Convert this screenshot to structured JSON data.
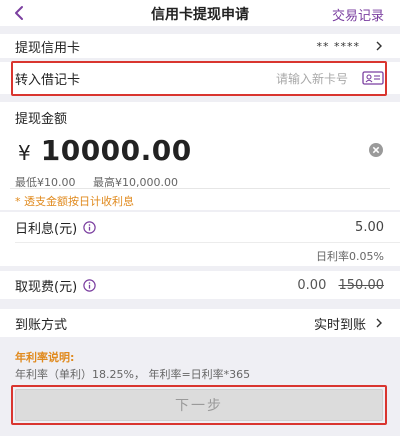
{
  "header": {
    "title": "信用卡提现申请",
    "records": "交易记录"
  },
  "credit_card": {
    "label": "提现信用卡",
    "value": "** ****"
  },
  "debit_card": {
    "label": "转入借记卡",
    "placeholder": "请输入新卡号"
  },
  "amount": {
    "title": "提现金额",
    "currency": "¥",
    "value": "10000.00",
    "min": "最低¥10.00",
    "max": "最高¥10,000.00",
    "notice": "* 透支金额按日计收利息"
  },
  "interest": {
    "label": "日利息(元)",
    "value": "5.00",
    "rate": "日利率0.05%"
  },
  "fee": {
    "label": "取现费(元)",
    "value": "0.00",
    "original": "150.00"
  },
  "arrival": {
    "label": "到账方式",
    "value": "实时到账"
  },
  "explain": {
    "title": "年利率说明:",
    "text": "年利率（单利）18.25%， 年利率=日利率*365"
  },
  "next_button": "下一步",
  "colors": {
    "accent": "#7b3fa0",
    "highlight": "#d9352f",
    "notice": "#e08a1e"
  }
}
